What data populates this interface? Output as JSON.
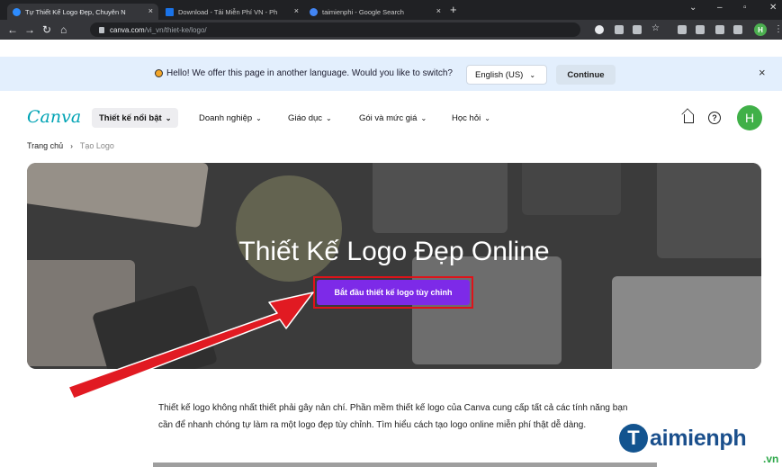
{
  "browser": {
    "tabs": [
      {
        "title": "Tự Thiết Kế Logo Đẹp, Chuyên N",
        "active": true,
        "favicon_color": "#2d8cff"
      },
      {
        "title": "Download - Tải Miễn Phí VN - Ph",
        "active": false,
        "favicon_color": "#1a73e8"
      },
      {
        "title": "taimienphi - Google Search",
        "active": false,
        "favicon_color": "#4285f4"
      }
    ],
    "new_tab": "+",
    "close": "×",
    "url_host": "canva.com",
    "url_path": "/vi_vn/thiet-ke/logo/",
    "profile_initial": "H"
  },
  "banner": {
    "message": "Hello! We offer this page in another language. Would you like to switch?",
    "language": "English (US)",
    "continue_label": "Continue",
    "close": "×"
  },
  "nav": {
    "logo": "Canva",
    "items": [
      "Thiết kế nổi bật",
      "Doanh nghiệp",
      "Giáo dục",
      "Gói và mức giá",
      "Học hỏi"
    ],
    "help": "?",
    "avatar_initial": "H"
  },
  "breadcrumb": {
    "home": "Trang chủ",
    "separator": "›",
    "current": "Tạo Logo"
  },
  "hero": {
    "title": "Thiết Kế Logo Đẹp Online",
    "cta_label": "Bắt đầu thiết kế logo tùy chỉnh"
  },
  "description": "Thiết kế logo không nhất thiết phải gây nản chí. Phần mềm thiết kế logo của Canva cung cấp tất cả các tính năng bạn cần để nhanh chóng tự làm ra một logo đẹp tùy chỉnh. Tìm hiểu cách tạo logo online miễn phí thật dễ dàng.",
  "watermark": {
    "brand": "aimienph",
    "initial": "T",
    "suffix": ".vn"
  },
  "colors": {
    "accent": "#7d2ae8",
    "highlight": "#e01219",
    "canva_logo": "#00a3b4",
    "avatar": "#40b048"
  }
}
